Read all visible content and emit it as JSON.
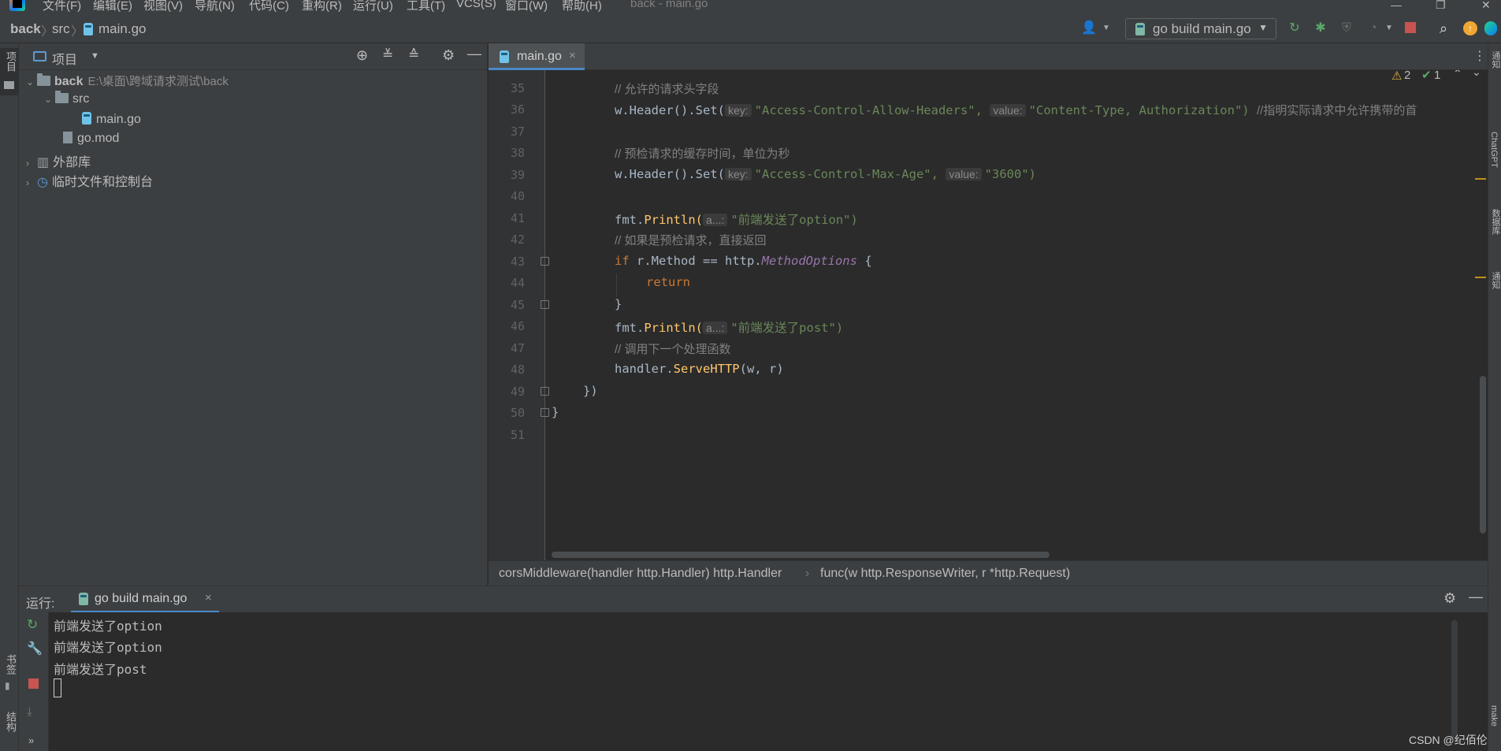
{
  "menu": {
    "items": [
      "文件(F)",
      "编辑(E)",
      "视图(V)",
      "导航(N)",
      "代码(C)",
      "重构(R)",
      "运行(U)",
      "工具(T)",
      "VCS(S)",
      "窗口(W)",
      "帮助(H)"
    ],
    "window_title": "back - main.go"
  },
  "breadcrumb": {
    "items": [
      "back",
      "src",
      "main.go"
    ]
  },
  "toolbar": {
    "run_config": "go build main.go"
  },
  "left_strip": {
    "project_label": "项目",
    "bookmarks_label": "书签",
    "structure_label": "结构"
  },
  "right_strip": {
    "labels": [
      "通知",
      "ChatGPT",
      "数据库",
      "通知",
      "make"
    ]
  },
  "project_panel": {
    "title": "项目",
    "tree": {
      "root_name": "back",
      "root_path": "E:\\桌面\\跨域请求测试\\back",
      "src": "src",
      "main_go": "main.go",
      "go_mod": "go.mod",
      "external_libs": "外部库",
      "scratches": "临时文件和控制台"
    }
  },
  "editor": {
    "tab_label": "main.go",
    "warnings": "2",
    "checks": "1",
    "line_numbers": [
      "35",
      "36",
      "37",
      "38",
      "39",
      "40",
      "41",
      "42",
      "43",
      "44",
      "45",
      "46",
      "47",
      "48",
      "49",
      "50",
      "51"
    ],
    "lines": {
      "l35_comment": "// 允许的请求头字段",
      "l36_code": "w.Header().Set(",
      "l36_key_hint": "key:",
      "l36_key": "\"Access-Control-Allow-Headers\",",
      "l36_value_hint": "value:",
      "l36_value": "\"Content-Type, Authorization\")",
      "l36_comment": "//指明实际请求中允许携带的首",
      "l38_comment": "// 预检请求的缓存时间，单位为秒",
      "l39_code": "w.Header().Set(",
      "l39_key_hint": "key:",
      "l39_key": "\"Access-Control-Max-Age\",",
      "l39_value_hint": "value:",
      "l39_value": "\"3600\")",
      "l41_fmt": "fmt.",
      "l41_fn": "Println(",
      "l41_hint": "a...:",
      "l41_str": "\"前端发送了option\")",
      "l42_comment": "// 如果是预检请求，直接返回",
      "l43_if": "if",
      "l43_mid": " r.Method == http.",
      "l43_const": "MethodOptions",
      "l43_end": " {",
      "l44_return": "return",
      "l45_close": "}",
      "l46_fmt": "fmt.",
      "l46_fn": "Println(",
      "l46_hint": "a...:",
      "l46_str": "\"前端发送了post\")",
      "l47_comment": "// 调用下一个处理函数",
      "l48_code": "handler.",
      "l48_fn": "ServeHTTP",
      "l48_args": "(w, r)",
      "l49_close": "})",
      "l50_close": "}"
    }
  },
  "editor_breadcrumb": {
    "func1": "corsMiddleware(handler http.Handler) http.Handler",
    "func2": "func(w http.ResponseWriter, r *http.Request)"
  },
  "run_panel": {
    "label": "运行:",
    "tab_label": "go build main.go",
    "output": [
      "前端发送了option",
      "前端发送了option",
      "前端发送了post"
    ]
  },
  "watermark": "CSDN @纪佰伦"
}
